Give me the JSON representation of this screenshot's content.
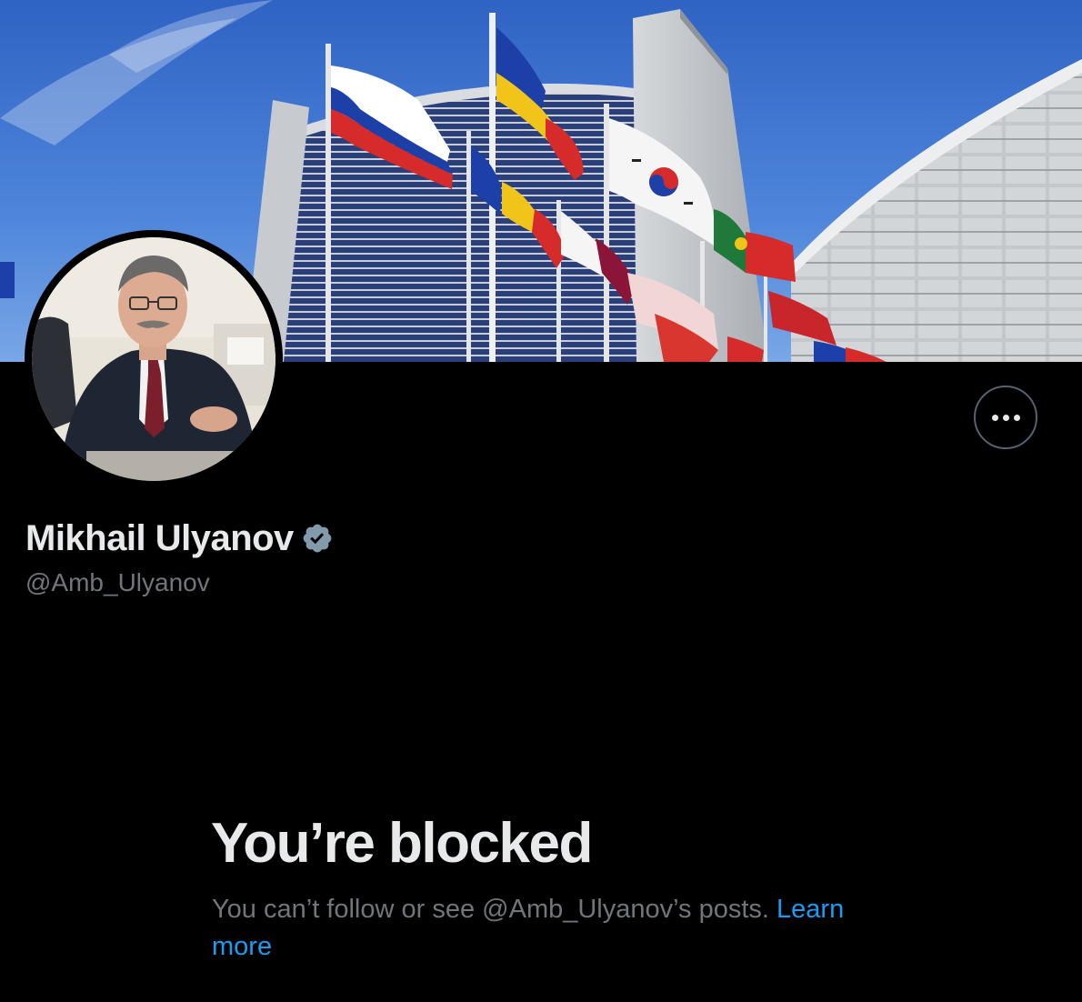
{
  "profile": {
    "display_name": "Mikhail Ulyanov",
    "handle": "@Amb_Ulyanov",
    "verified": true,
    "verified_color": "#829aab"
  },
  "actions": {
    "more_icon": "more-horizontal-icon"
  },
  "blocked": {
    "title": "You’re blocked",
    "message": "You can’t follow or see @Amb_Ulyanov’s posts.",
    "learn_more": "Learn more",
    "link_color": "#1d9bf0"
  },
  "theme": {
    "background": "#000000",
    "primary_text": "#e7e9ea",
    "secondary_text": "#71767b"
  }
}
